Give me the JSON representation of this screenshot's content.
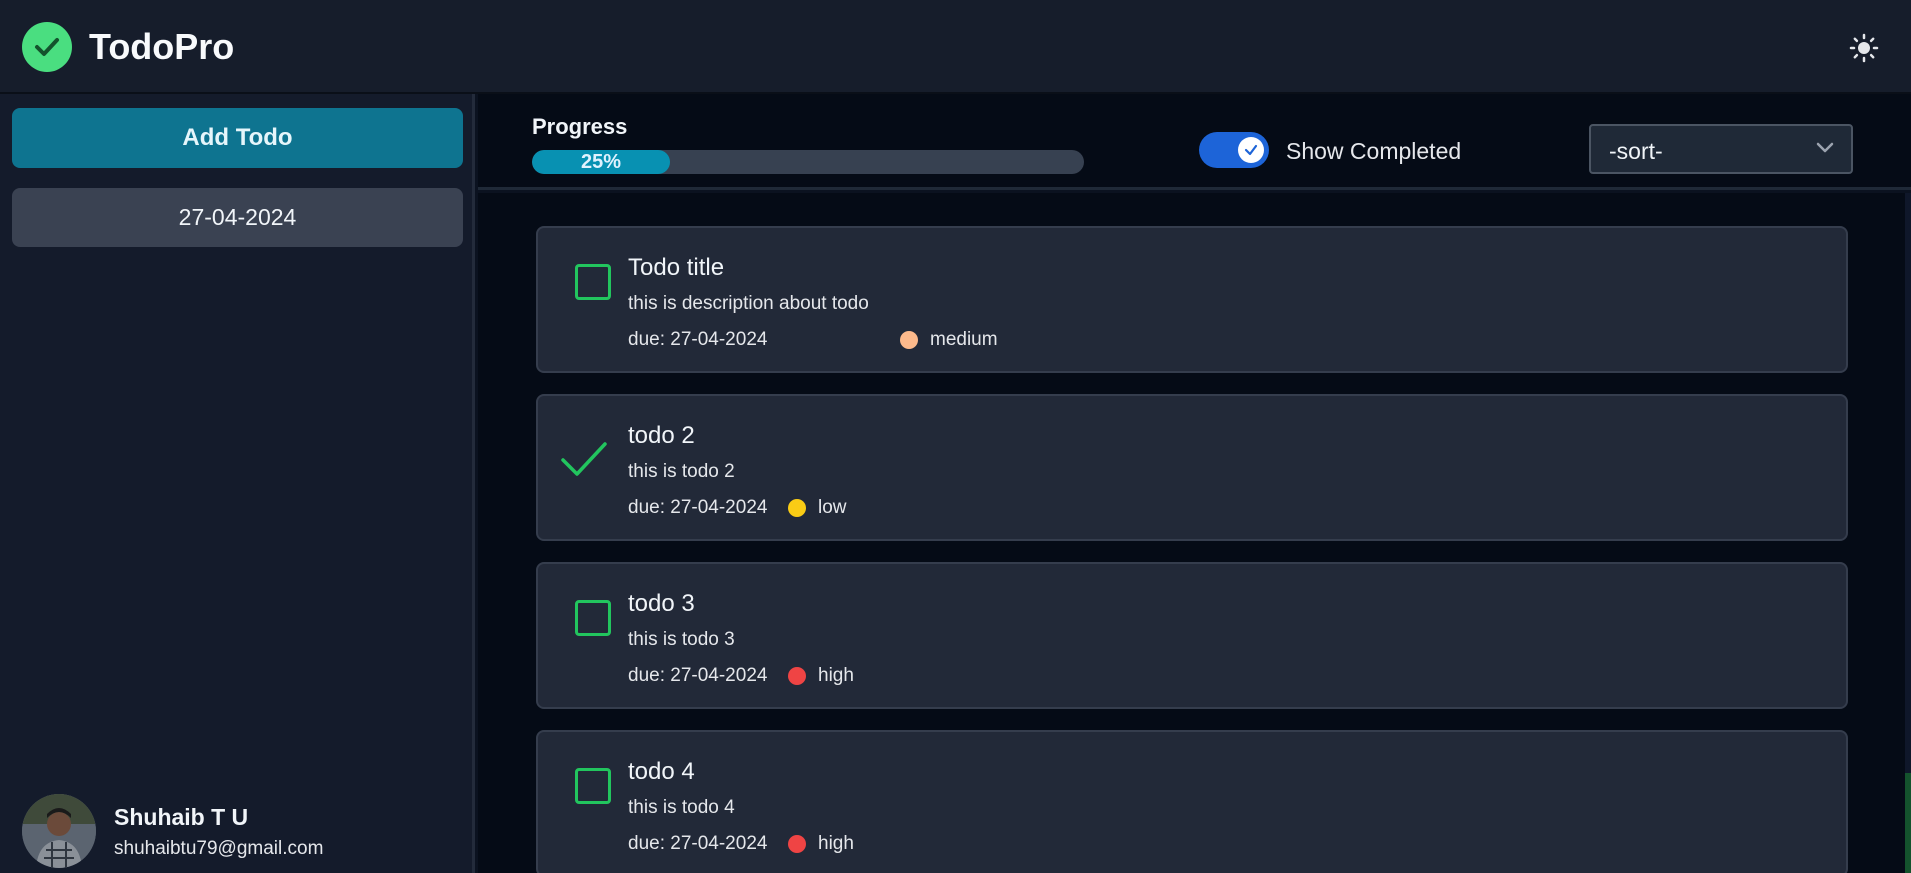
{
  "app": {
    "title": "TodoPro"
  },
  "sidebar": {
    "add_button": "Add Todo",
    "date_filter": "27-04-2024",
    "user": {
      "name": "Shuhaib T U",
      "email": "shuhaibtu79@gmail.com"
    }
  },
  "toolbar": {
    "progress_label": "Progress",
    "progress_percent": 25,
    "progress_text": "25%",
    "show_completed_label": "Show Completed",
    "show_completed": true,
    "sort_value": "-sort-"
  },
  "todos": [
    {
      "title": "Todo title",
      "description": "this is description about todo",
      "due": "due: 27-04-2024",
      "priority": "medium",
      "priority_color": "#fdba8c",
      "completed": false
    },
    {
      "title": "todo 2",
      "description": "this is todo 2",
      "due": "due: 27-04-2024",
      "priority": "low",
      "priority_color": "#facc15",
      "completed": true
    },
    {
      "title": "todo 3",
      "description": "this is todo 3",
      "due": "due: 27-04-2024",
      "priority": "high",
      "priority_color": "#ef4444",
      "completed": false
    },
    {
      "title": "todo 4",
      "description": "this is todo 4",
      "due": "due: 27-04-2024",
      "priority": "high",
      "priority_color": "#ef4444",
      "completed": false
    }
  ],
  "colors": {
    "accent": "#0e7490",
    "check": "#22c55e",
    "toggle": "#1d64d8"
  }
}
